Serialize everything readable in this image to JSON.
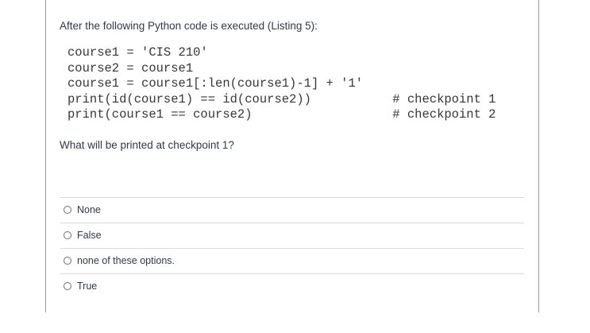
{
  "question": {
    "intro": "After the following Python code is executed (Listing 5):",
    "code": "course1 = 'CIS 210'\ncourse2 = course1\ncourse1 = course1[:len(course1)-1] + '1'\nprint(id(course1) == id(course2))           # checkpoint 1\nprint(course1 == course2)                   # checkpoint 2",
    "prompt": "What will be printed at checkpoint 1?"
  },
  "answers": {
    "options": [
      {
        "label": "None",
        "selected": false
      },
      {
        "label": "False",
        "selected": false
      },
      {
        "label": "none of these options.",
        "selected": false
      },
      {
        "label": "True",
        "selected": false
      }
    ]
  },
  "colors": {
    "question_text": "#2d3b45",
    "code_text": "#373737",
    "divider": "#d9d9d9",
    "panel_border": "#9b9b9b"
  }
}
